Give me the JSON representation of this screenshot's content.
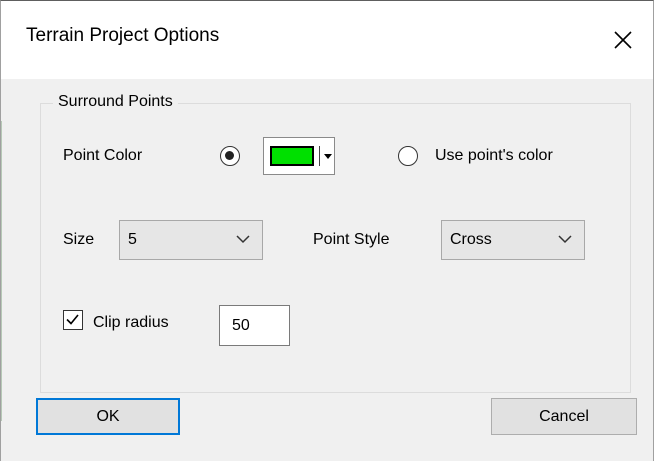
{
  "window": {
    "title": "Terrain Project Options",
    "close_icon": "close-icon"
  },
  "surround_points": {
    "group_label": "Surround Points",
    "point_color_label": "Point Color",
    "point_color_option_selected": true,
    "color_value": "#00e000",
    "use_points_color_label": "Use point's color",
    "use_points_color_selected": false,
    "size_label": "Size",
    "size_value": "5",
    "point_style_label": "Point Style",
    "point_style_value": "Cross",
    "clip_radius_label": "Clip radius",
    "clip_radius_checked": true,
    "clip_radius_value": "50"
  },
  "buttons": {
    "ok_label": "OK",
    "cancel_label": "Cancel"
  },
  "colors": {
    "focus_border": "#0078d7",
    "swatch": "#00e000"
  }
}
